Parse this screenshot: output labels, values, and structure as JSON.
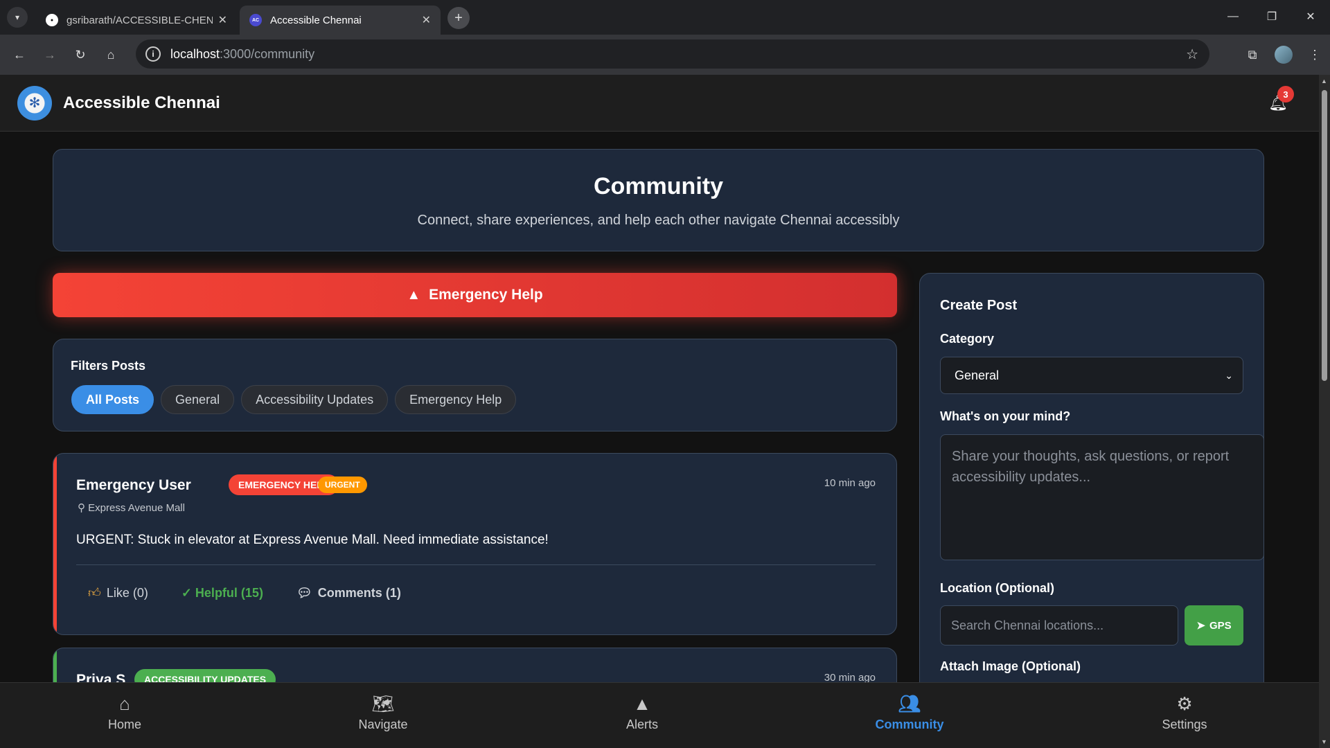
{
  "browser": {
    "tabs": [
      {
        "title": "gsribarath/ACCESSIBLE-CHENN",
        "favicon": "github-icon"
      },
      {
        "title": "Accessible Chennai",
        "favicon": "AC"
      }
    ],
    "url_host": "localhost",
    "url_path": ":3000/community"
  },
  "header": {
    "brand": "Accessible Chennai",
    "notification_count": "3"
  },
  "hero": {
    "title": "Community",
    "subtitle": "Connect, share experiences, and help each other navigate Chennai accessibly"
  },
  "emergency_button": {
    "label": "Emergency Help"
  },
  "filters": {
    "title": "Filters Posts",
    "chips": [
      "All Posts",
      "General",
      "Accessibility Updates",
      "Emergency Help"
    ],
    "active": "All Posts"
  },
  "posts": [
    {
      "user": "Emergency User",
      "category": "EMERGENCY HELP",
      "priority": "URGENT",
      "time": "10 min ago",
      "location": "Express Avenue Mall",
      "text": "URGENT: Stuck in elevator at Express Avenue Mall. Need immediate assistance!",
      "like": "Like (0)",
      "helpful": "✓ Helpful (15)",
      "comments": "Comments (1)",
      "accent_color": "#f44336"
    },
    {
      "user": "Priya S",
      "category": "ACCESSIBILITY UPDATES",
      "time": "30 min ago",
      "accent_color": "#4caf50"
    }
  ],
  "create_post": {
    "title": "Create Post",
    "category_label": "Category",
    "category_value": "General",
    "mind_label": "What's on your mind?",
    "mind_placeholder": "Share your thoughts, ask questions, or report accessibility updates...",
    "location_label": "Location (Optional)",
    "location_placeholder": "Search Chennai locations...",
    "gps_label": "GPS",
    "image_label": "Attach Image (Optional)"
  },
  "bottom_nav": [
    {
      "label": "Home",
      "icon": "home-icon"
    },
    {
      "label": "Navigate",
      "icon": "map-marker-icon"
    },
    {
      "label": "Alerts",
      "icon": "warning-icon"
    },
    {
      "label": "Community",
      "icon": "users-icon",
      "active": true
    },
    {
      "label": "Settings",
      "icon": "gear-icon"
    }
  ],
  "colors": {
    "accent": "#3a8ee6",
    "emergency": "#f44336",
    "success": "#4caf50",
    "warning": "#ff9800"
  }
}
